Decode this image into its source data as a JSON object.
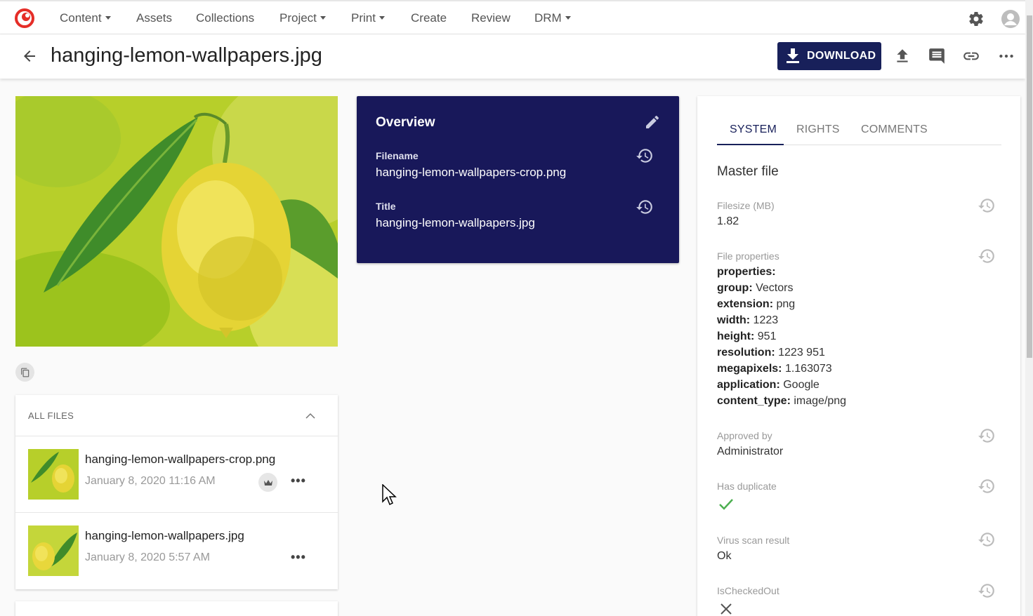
{
  "nav": {
    "items": [
      {
        "label": "Content",
        "caret": true
      },
      {
        "label": "Assets",
        "caret": false
      },
      {
        "label": "Collections",
        "caret": false
      },
      {
        "label": "Project",
        "caret": true
      },
      {
        "label": "Print",
        "caret": true
      },
      {
        "label": "Create",
        "caret": false
      },
      {
        "label": "Review",
        "caret": false
      },
      {
        "label": "DRM",
        "caret": true
      }
    ],
    "icons": [
      "logo-icon",
      "gear-icon",
      "user-avatar-icon"
    ]
  },
  "header": {
    "title": "hanging-lemon-wallpapers.jpg",
    "download_label": "DOWNLOAD",
    "icons": [
      "back-arrow-icon",
      "upload-icon",
      "comment-icon",
      "link-icon",
      "more-icon"
    ]
  },
  "files": {
    "heading": "ALL FILES",
    "items": [
      {
        "name": "hanging-lemon-wallpapers-crop.png",
        "date": "January 8, 2020 11:16 AM",
        "master": true,
        "more": "•••"
      },
      {
        "name": "hanging-lemon-wallpapers.jpg",
        "date": "January 8, 2020 5:57 AM",
        "master": false,
        "more": "•••"
      }
    ]
  },
  "overview": {
    "title": "Overview",
    "fields": [
      {
        "label": "Filename",
        "value": "hanging-lemon-wallpapers-crop.png"
      },
      {
        "label": "Title",
        "value": "hanging-lemon-wallpapers.jpg"
      }
    ]
  },
  "panel": {
    "tabs": [
      "SYSTEM",
      "RIGHTS",
      "COMMENTS"
    ],
    "active_tab": "SYSTEM",
    "section_title": "Master file",
    "filesize_label": "Filesize (MB)",
    "filesize_value": "1.82",
    "fileprops_label": "File properties",
    "fileprops": [
      {
        "key": "properties:",
        "value": ""
      },
      {
        "key": "group:",
        "value": "Vectors"
      },
      {
        "key": "extension:",
        "value": "png"
      },
      {
        "key": "width:",
        "value": "1223"
      },
      {
        "key": "height:",
        "value": "951"
      },
      {
        "key": "resolution:",
        "value": "1223 951"
      },
      {
        "key": "megapixels:",
        "value": "1.163073"
      },
      {
        "key": "application:",
        "value": "Google"
      },
      {
        "key": "content_type:",
        "value": "image/png"
      }
    ],
    "approved_label": "Approved by",
    "approved_value": "Administrator",
    "duplicate_label": "Has duplicate",
    "duplicate_value": true,
    "virus_label": "Virus scan result",
    "virus_value": "Ok",
    "checkedout_label": "IsCheckedOut",
    "checkedout_value": false
  },
  "colors": {
    "brand_navy": "#18205a",
    "overview_bg": "#18185a",
    "logo_red": "#e52d27",
    "check_green": "#4caf50"
  }
}
